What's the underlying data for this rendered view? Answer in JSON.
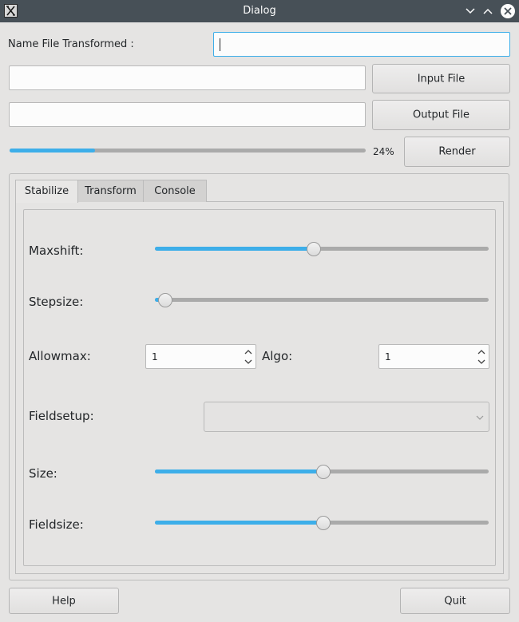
{
  "window": {
    "title": "Dialog",
    "icons": [
      "app-icon",
      "minimize-icon",
      "maximize-icon",
      "close-icon"
    ]
  },
  "top": {
    "name_label": "Name File Transformed :",
    "name_value": "",
    "input_path": "",
    "output_path": "",
    "input_button": "Input File",
    "output_button": "Output File",
    "render_button": "Render",
    "progress": 24,
    "progress_text": "24%"
  },
  "tabs": [
    "Stabilize",
    "Transform",
    "Console"
  ],
  "active_tab": "Stabilize",
  "stabilize": {
    "maxshift_label": "Maxshift:",
    "maxshift_value": 0.47,
    "stepsize_label": "Stepsize:",
    "stepsize_value": 0.0,
    "allowmax_label": "Allowmax:",
    "allowmax_value": "1",
    "algo_label": "Algo:",
    "algo_value": "1",
    "fieldsetup_label": "Fieldsetup:",
    "fieldsetup_value": "",
    "size_label": "Size:",
    "size_value": 0.5,
    "fieldsize_label": "Fieldsize:",
    "fieldsize_value": 0.5
  },
  "bottom": {
    "help_button": "Help",
    "quit_button": "Quit"
  },
  "colors": {
    "accent": "#3daee9",
    "titlebar": "#475057",
    "window_bg": "#e5e4e3"
  }
}
